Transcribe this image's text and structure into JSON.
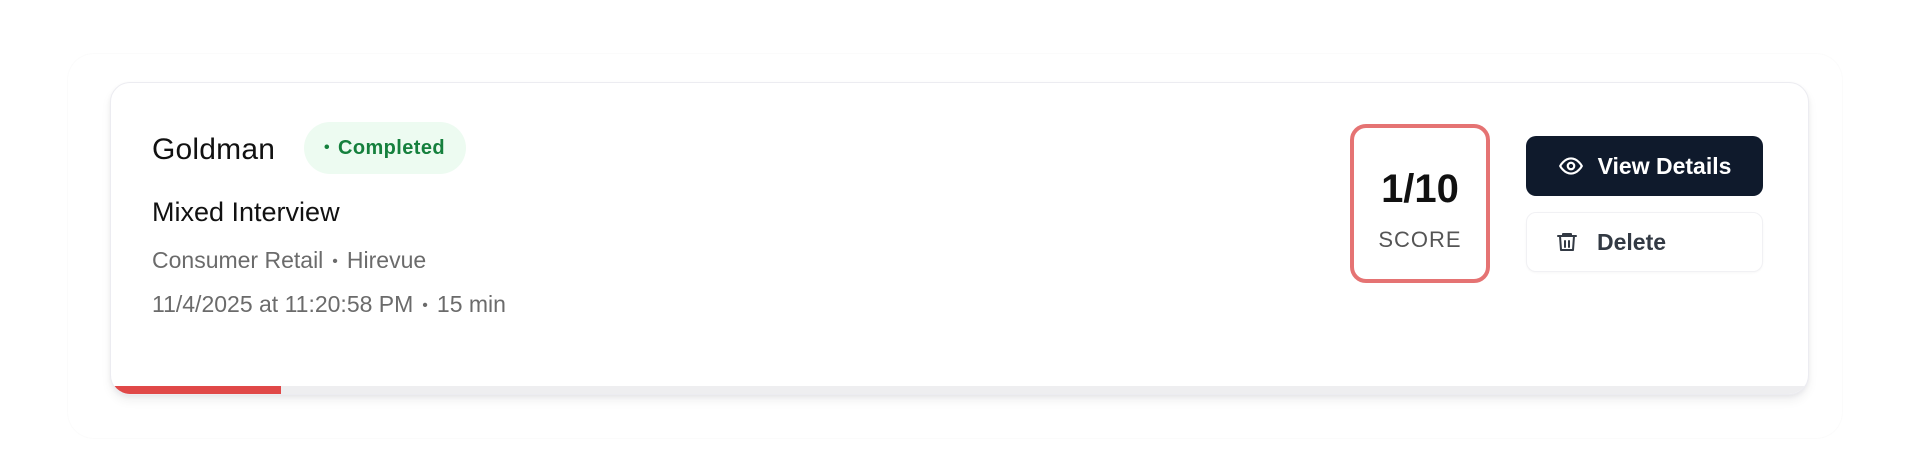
{
  "interview": {
    "company": "Goldman",
    "status": "Completed",
    "title": "Mixed Interview",
    "industry": "Consumer Retail",
    "platform": "Hirevue",
    "datetime": "11/4/2025 at 11:20:58 PM",
    "duration": "15 min",
    "separator": "•"
  },
  "score": {
    "value": "1/10",
    "label": "SCORE",
    "fraction": 0.1
  },
  "actions": {
    "view_label": "View Details",
    "delete_label": "Delete"
  },
  "colors": {
    "status_bg": "#edfbf1",
    "status_text": "#15803d",
    "score_border": "#e57373",
    "progress_fill": "#e04848",
    "primary_button": "#0f1a2c"
  },
  "icons": {
    "view": "eye-icon",
    "delete": "trash-icon",
    "status": "dot-icon"
  }
}
